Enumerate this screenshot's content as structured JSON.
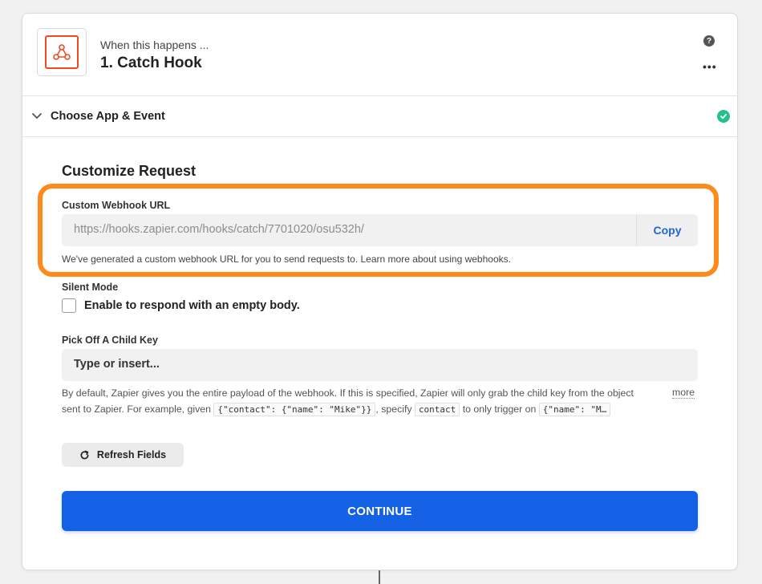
{
  "step": {
    "subtitle": "When this happens ...",
    "title": "1. Catch Hook",
    "help_glyph": "?",
    "more_glyph": "•••"
  },
  "section": {
    "label": "Choose App & Event"
  },
  "customize": {
    "heading": "Customize Request",
    "webhook_label": "Custom Webhook URL",
    "webhook_url": "https://hooks.zapier.com/hooks/catch/7701020/osu532h/",
    "copy_label": "Copy",
    "webhook_helper": "We've generated a custom webhook URL for you to send requests to. Learn more about using webhooks.",
    "silent_label": "Silent Mode",
    "silent_checkbox_label": "Enable to respond with an empty body.",
    "child_key_label": "Pick Off A Child Key",
    "child_key_placeholder": "Type or insert...",
    "desc_line1": "By default, Zapier gives you the entire payload of the webhook. If this is specified, Zapier will only grab the child key from the object",
    "desc_line2_a": "sent to Zapier. For example, given",
    "desc_code1": "{\"contact\": {\"name\": \"Mike\"}}",
    "desc_line2_b": ", specify",
    "desc_code2": "contact",
    "desc_line2_c": "to only trigger on",
    "desc_code3": "{\"name\": \"M…",
    "more_label": "more",
    "refresh_label": "Refresh Fields",
    "continue_label": "CONTINUE"
  },
  "colors": {
    "highlight": "#ff8a1c",
    "primary": "#1461e6",
    "success": "#25c18b",
    "app_brand": "#ef4c1e"
  },
  "icons": {
    "app": "webhook-icon",
    "help": "help-icon",
    "more": "more-options-icon",
    "collapse": "chevron-down-icon",
    "status": "check-circle-icon",
    "refresh": "refresh-icon"
  }
}
